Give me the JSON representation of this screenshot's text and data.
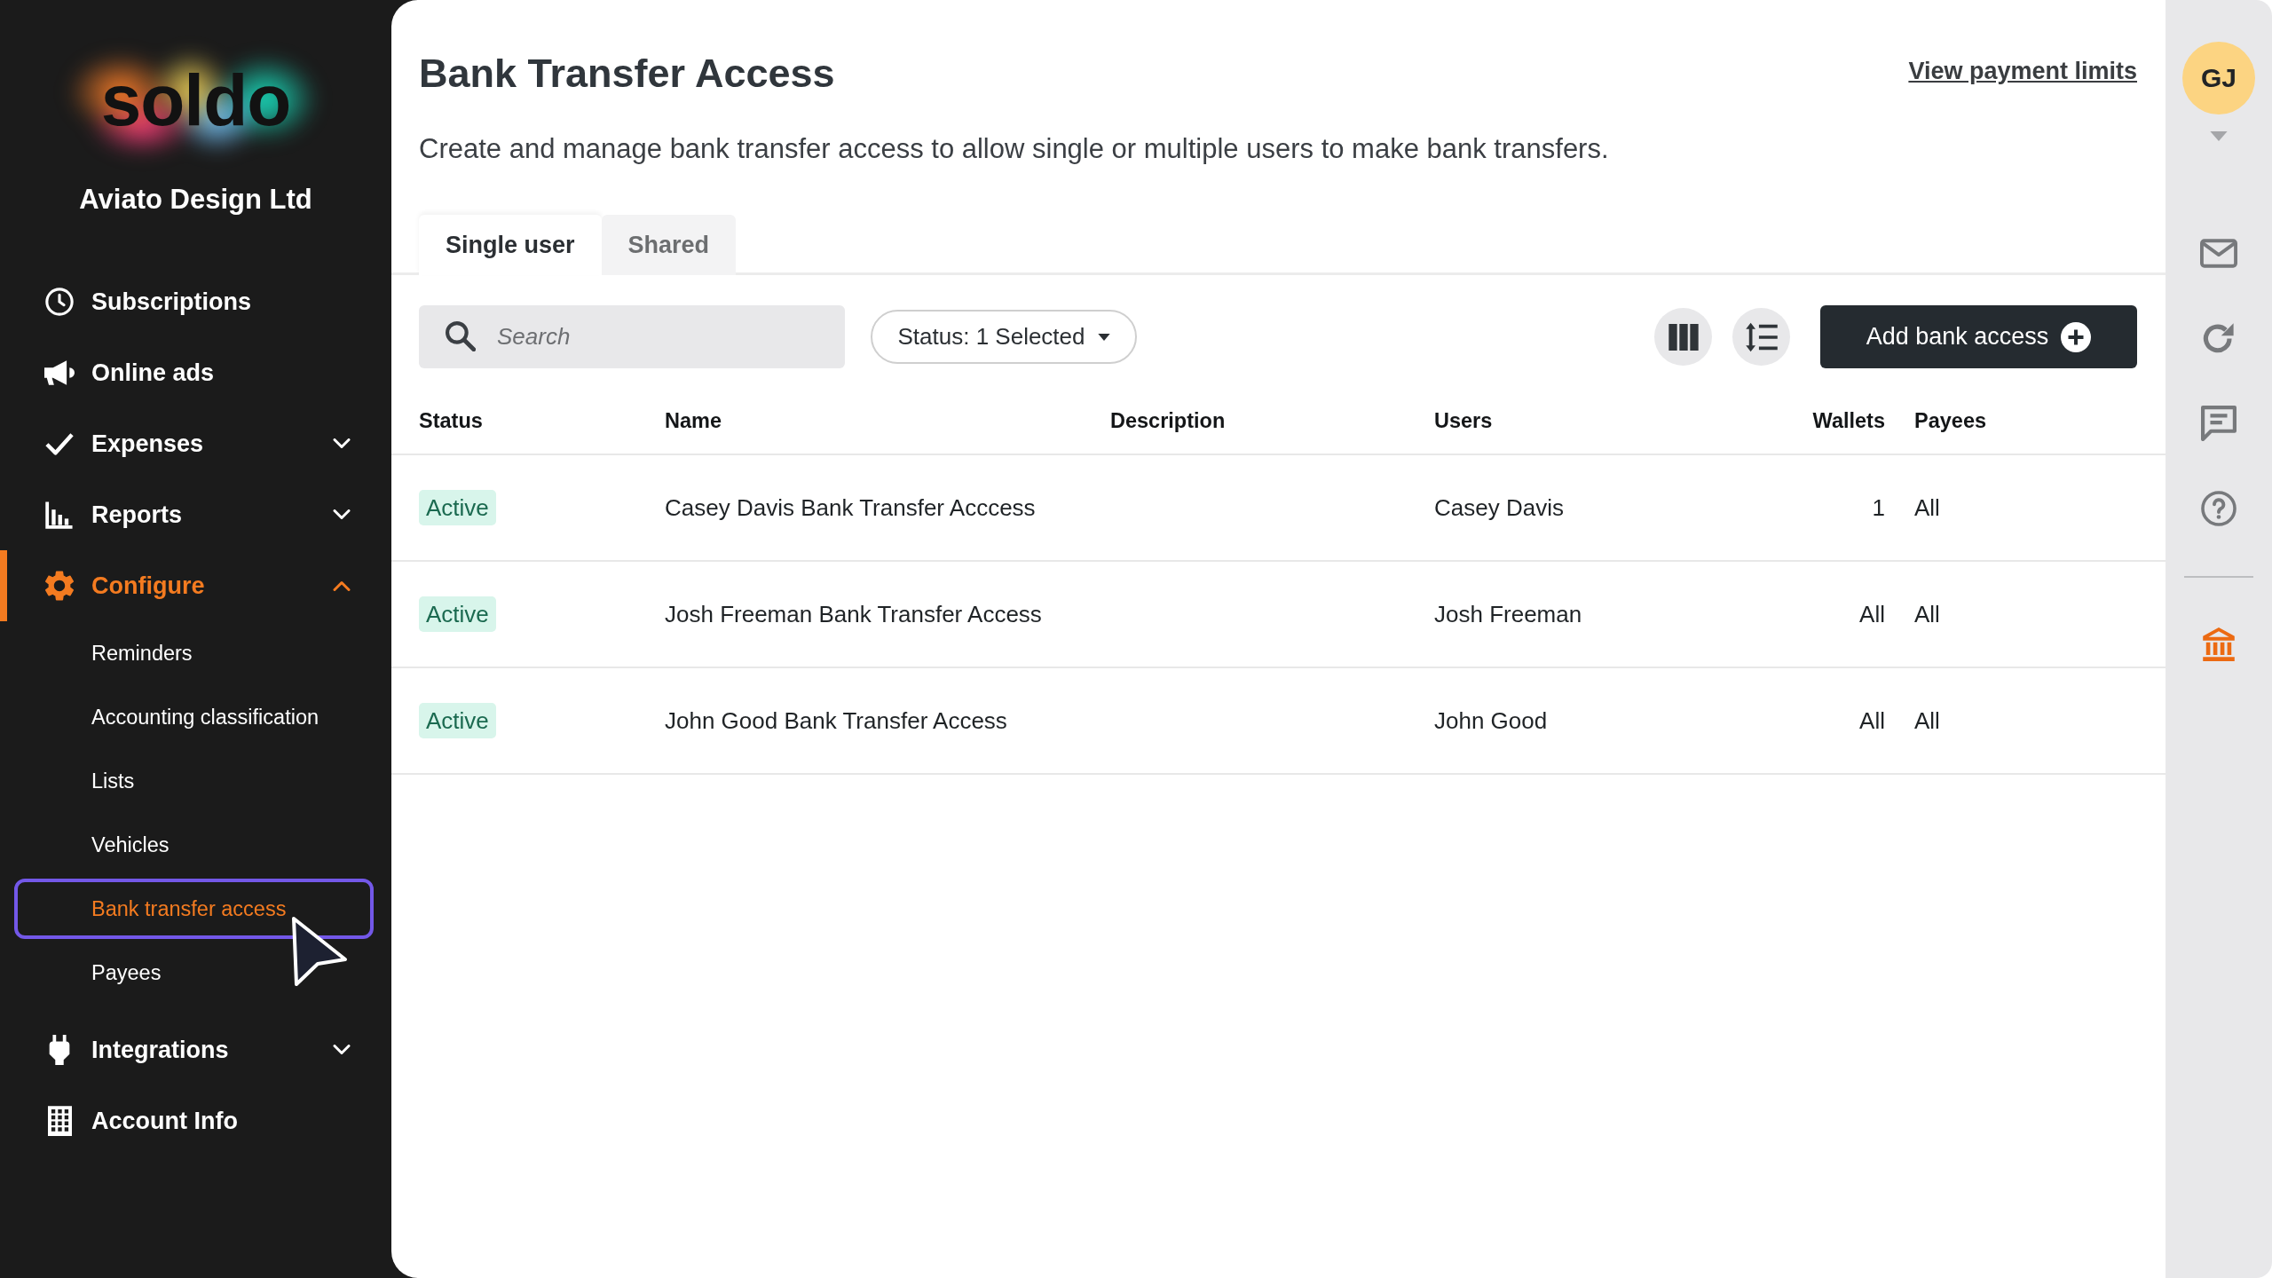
{
  "sidebar": {
    "logo": "soldo",
    "company": "Aviato Design Ltd",
    "items": [
      {
        "label": "Subscriptions",
        "kind": "link",
        "selected": false
      },
      {
        "label": "Online ads",
        "kind": "link",
        "selected": false
      },
      {
        "label": "Expenses",
        "kind": "group",
        "expanded": false,
        "selected": false
      },
      {
        "label": "Reports",
        "kind": "group",
        "expanded": false,
        "selected": false
      },
      {
        "label": "Configure",
        "kind": "group",
        "expanded": true,
        "selected": true,
        "children": [
          {
            "label": "Reminders",
            "selected": false
          },
          {
            "label": "Accounting classification",
            "selected": false
          },
          {
            "label": "Lists",
            "selected": false
          },
          {
            "label": "Vehicles",
            "selected": false
          },
          {
            "label": "Bank transfer access",
            "selected": true
          },
          {
            "label": "Payees",
            "selected": false
          }
        ]
      },
      {
        "label": "Integrations",
        "kind": "group",
        "expanded": false,
        "selected": false
      },
      {
        "label": "Account Info",
        "kind": "link",
        "selected": false
      }
    ]
  },
  "header": {
    "title": "Bank Transfer Access",
    "link": "View payment limits",
    "description": "Create and manage bank transfer access to allow single or multiple users to make bank transfers."
  },
  "tabs": [
    {
      "label": "Single user",
      "selected": true
    },
    {
      "label": "Shared",
      "selected": false
    }
  ],
  "toolbar": {
    "search": {
      "placeholder": "Search"
    },
    "status_filter": "Status: 1 Selected",
    "add_button": "Add bank access"
  },
  "table": {
    "columns": [
      "Status",
      "Name",
      "Description",
      "Users",
      "Wallets",
      "Payees"
    ],
    "rows": [
      {
        "status": "Active",
        "name": "Casey Davis Bank Transfer Acccess",
        "users": "Casey Davis",
        "wallets": "1",
        "payees": "All"
      },
      {
        "status": "Active",
        "name": "Josh Freeman Bank Transfer Access",
        "users": "Josh Freeman",
        "wallets": "All",
        "payees": "All"
      },
      {
        "status": "Active",
        "name": "John Good Bank Transfer Access",
        "users": "John Good",
        "wallets": "All",
        "payees": "All"
      }
    ]
  },
  "account": {
    "initials": "GJ"
  },
  "rail_items": [
    {
      "selected": false
    },
    {
      "selected": false
    },
    {
      "selected": false
    },
    {
      "selected": false
    },
    {
      "selected": true
    }
  ]
}
